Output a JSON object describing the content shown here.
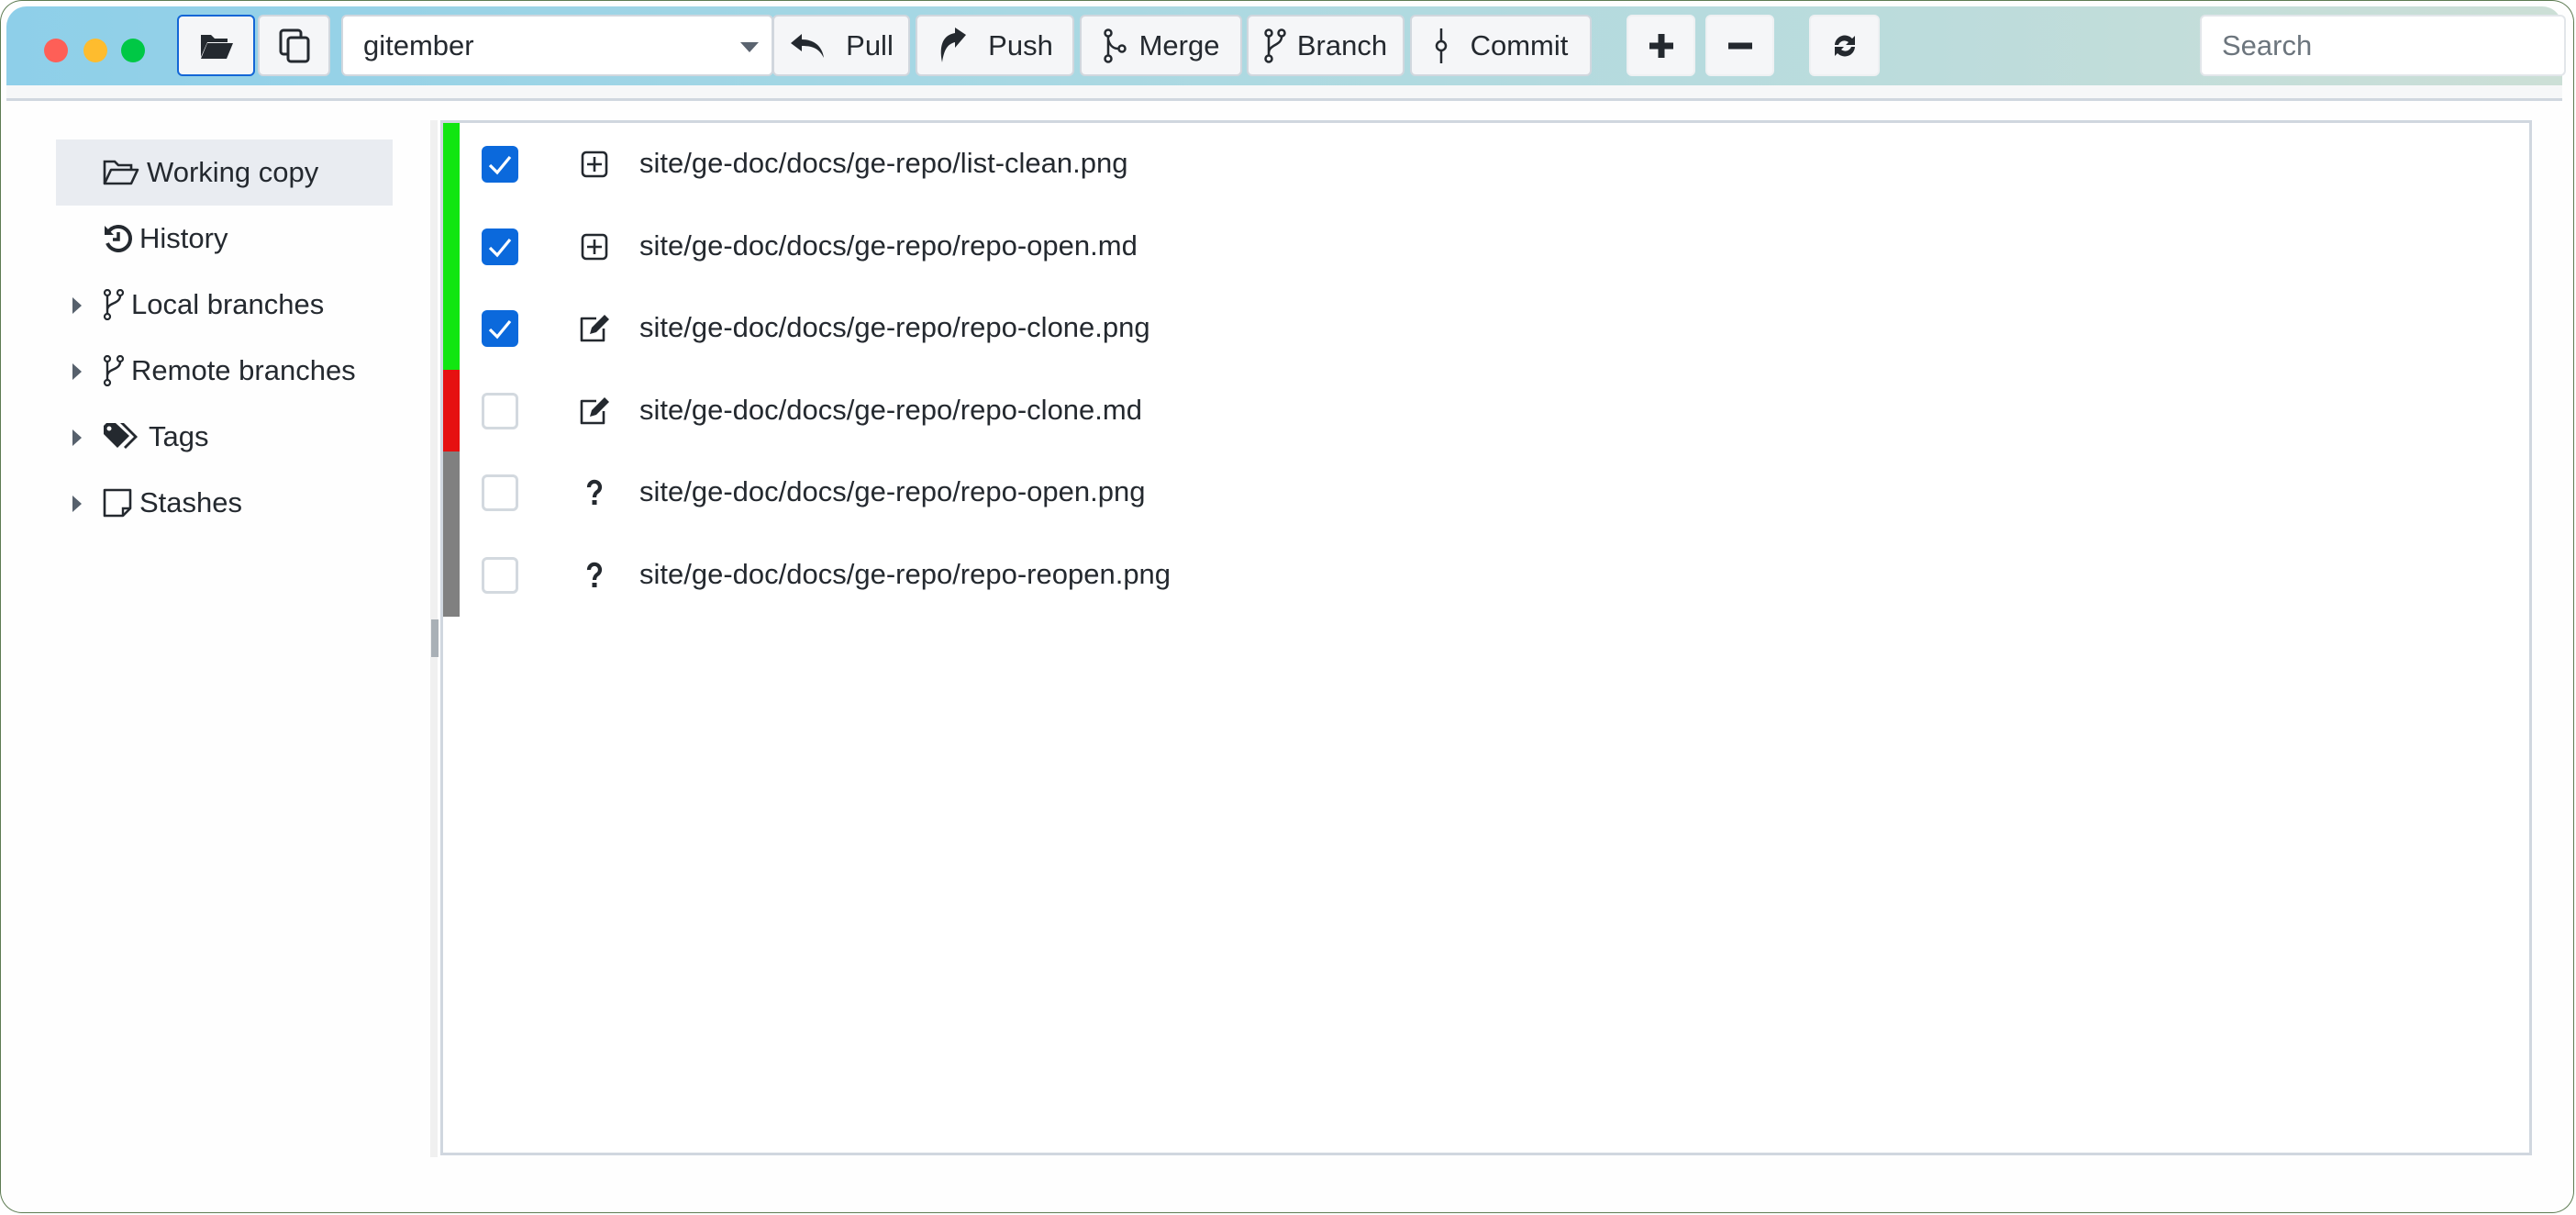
{
  "window": {
    "traffic_lights": [
      {
        "name": "close",
        "color": "#fe5f57"
      },
      {
        "name": "minimize",
        "color": "#febc2e"
      },
      {
        "name": "maximize",
        "color": "#00c845"
      }
    ]
  },
  "toolbar": {
    "open_repo_icon": "folder-open-icon",
    "clone_icon": "copy-icon",
    "repo_selector": {
      "value": "gitember"
    },
    "buttons": {
      "pull": {
        "label": "Pull",
        "icon": "pull-icon"
      },
      "push": {
        "label": "Push",
        "icon": "push-icon"
      },
      "merge": {
        "label": "Merge",
        "icon": "merge-icon"
      },
      "branch": {
        "label": "Branch",
        "icon": "branch-icon"
      },
      "commit": {
        "label": "Commit",
        "icon": "commit-icon"
      }
    },
    "stage_icon": "plus-icon",
    "unstage_icon": "minus-icon",
    "refresh_icon": "refresh-icon",
    "search": {
      "placeholder": "Search",
      "value": ""
    }
  },
  "sidebar": {
    "items": [
      {
        "label": "Working copy",
        "icon": "folder-open-icon",
        "selected": true,
        "expandable": false
      },
      {
        "label": "History",
        "icon": "history-icon",
        "selected": false,
        "expandable": false
      },
      {
        "label": "Local branches",
        "icon": "branch-icon",
        "selected": false,
        "expandable": true
      },
      {
        "label": "Remote branches",
        "icon": "branch-icon",
        "selected": false,
        "expandable": true
      },
      {
        "label": "Tags",
        "icon": "tags-icon",
        "selected": false,
        "expandable": true
      },
      {
        "label": "Stashes",
        "icon": "sticky-note-icon",
        "selected": false,
        "expandable": true
      }
    ]
  },
  "status_colors": {
    "staged": "#11e611",
    "modified": "#e61111",
    "untracked": "#808080"
  },
  "files": [
    {
      "path": "site/ge-doc/docs/ge-repo/list-clean.png",
      "checked": true,
      "status": "added",
      "stripe": "staged"
    },
    {
      "path": "site/ge-doc/docs/ge-repo/repo-open.md",
      "checked": true,
      "status": "added",
      "stripe": "staged"
    },
    {
      "path": "site/ge-doc/docs/ge-repo/repo-clone.png",
      "checked": true,
      "status": "modified",
      "stripe": "staged"
    },
    {
      "path": "site/ge-doc/docs/ge-repo/repo-clone.md",
      "checked": false,
      "status": "modified",
      "stripe": "modified"
    },
    {
      "path": "site/ge-doc/docs/ge-repo/repo-open.png",
      "checked": false,
      "status": "untracked",
      "stripe": "untracked"
    },
    {
      "path": "site/ge-doc/docs/ge-repo/repo-reopen.png",
      "checked": false,
      "status": "untracked",
      "stripe": "untracked"
    }
  ]
}
